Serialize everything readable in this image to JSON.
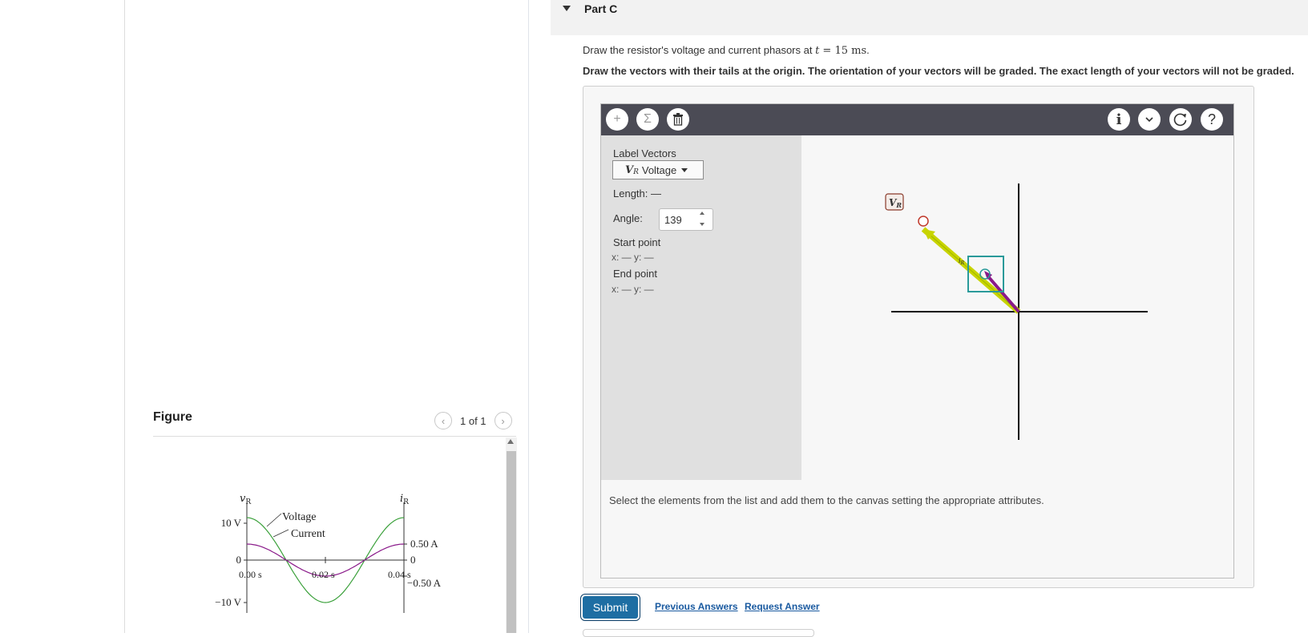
{
  "figure": {
    "title": "Figure",
    "pager": "1 of 1",
    "graph": {
      "left_axis_label": "v",
      "left_axis_sub": "R",
      "right_axis_label": "i",
      "right_axis_sub": "R",
      "left_ticks": [
        "10 V",
        "0",
        "−10 V"
      ],
      "right_ticks": [
        "0.50 A",
        "0",
        "−0.50 A"
      ],
      "time_ticks": [
        "0.00 s",
        "0.02 s",
        "0.04 s"
      ],
      "legend_voltage": "Voltage",
      "legend_current": "Current",
      "voltage_color": "#3aa03a",
      "current_color": "#8a1a8a"
    }
  },
  "part": {
    "title": "Part C",
    "question_prefix": "Draw the resistor's voltage and current phasors at ",
    "question_var": "t",
    "question_eq": " = 15 ",
    "question_unit": "ms",
    "question_suffix": ".",
    "instruction": "Draw the vectors with their tails at the origin. The orientation of your vectors will be graded. The exact length of your vectors will not be graded."
  },
  "tool": {
    "toolbar": {
      "add_icon": "+",
      "sum_icon": "Σ",
      "trash_icon": "🗑",
      "info_icon": "i",
      "dropdown_icon": "⌄",
      "reset_icon": "⟳",
      "help_icon": "?"
    },
    "panel": {
      "label_vectors": "Label Vectors",
      "selected_vector_symbol": "V",
      "selected_vector_sub": "R",
      "selected_vector_name": "Voltage",
      "length_label": "Length:",
      "length_value": "—",
      "angle_label": "Angle:",
      "angle_value": "139",
      "start_point_label": "Start point",
      "start_point_coords": "x: —  y: —",
      "end_point_label": "End point",
      "end_point_coords": "x: —  y: —"
    },
    "canvas": {
      "vr_label": "V",
      "vr_sub": "R",
      "ir_label": "i",
      "ir_sub": "R",
      "voltage_vector_angle_deg": 139,
      "voltage_color": "#c8d400",
      "current_color": "#8a1a8a",
      "selection_color": "#2a9a9a"
    },
    "hint": "Select the elements from the list and add them to the canvas setting the appropriate attributes."
  },
  "actions": {
    "submit": "Submit",
    "previous_answers": "Previous Answers",
    "request_answer": "Request Answer"
  }
}
